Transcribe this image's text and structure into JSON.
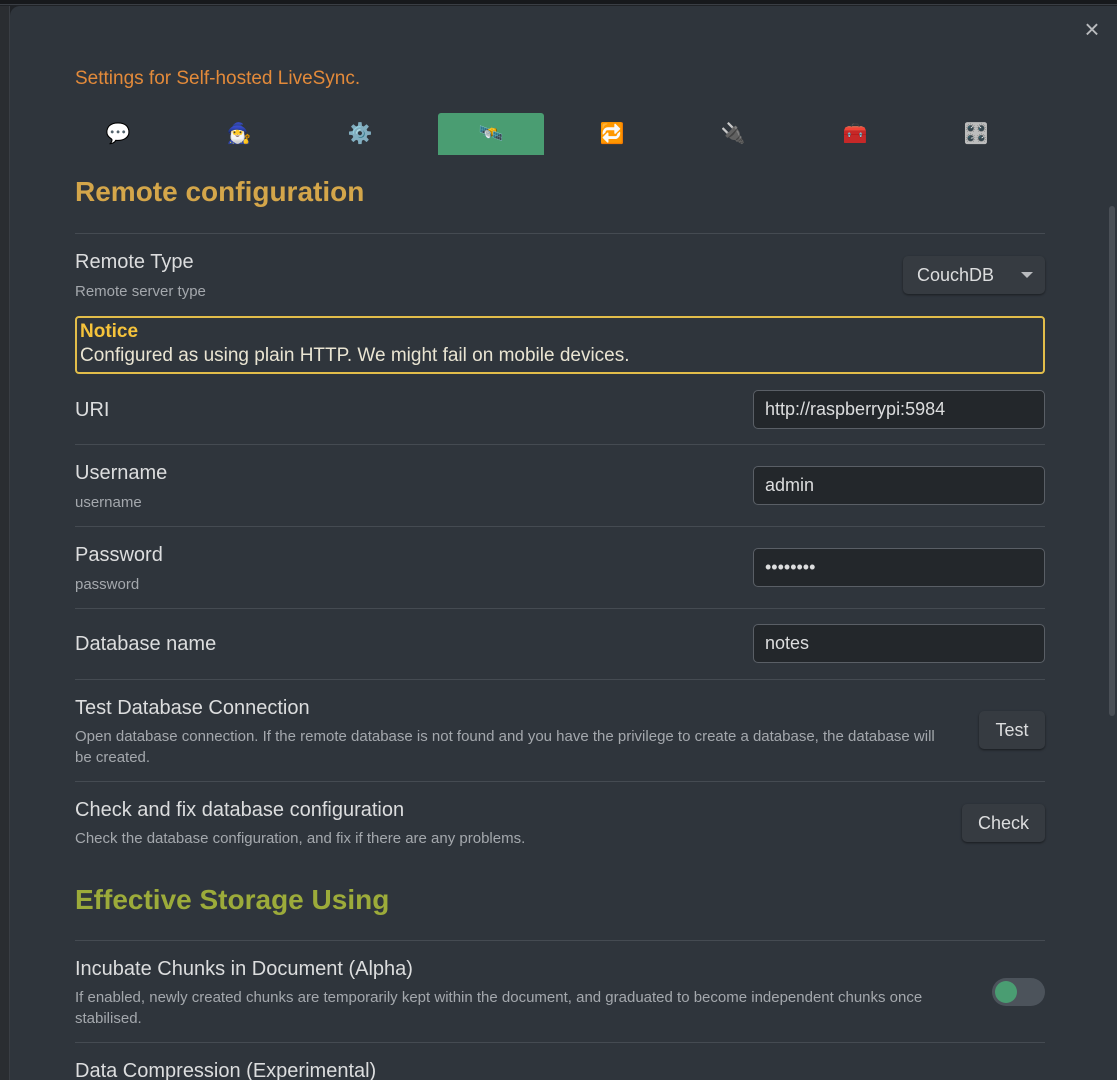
{
  "modal": {
    "title": "Settings for Self-hosted LiveSync.",
    "close_glyph": "×"
  },
  "tabs": [
    {
      "icon": "💬",
      "name": "speech-balloon-icon"
    },
    {
      "icon": "🧙‍♂️",
      "name": "wizard-icon"
    },
    {
      "icon": "⚙️",
      "name": "gear-icon"
    },
    {
      "icon": "🛰️",
      "name": "satellite-icon",
      "active": true
    },
    {
      "icon": "🔁",
      "name": "repeat-icon"
    },
    {
      "icon": "🔌",
      "name": "plug-icon"
    },
    {
      "icon": "🧰",
      "name": "toolbox-icon"
    },
    {
      "icon": "🎛️",
      "name": "control-knobs-icon"
    }
  ],
  "remote_section": {
    "title": "Remote configuration",
    "remote_type": {
      "name": "Remote Type",
      "desc": "Remote server type",
      "value": "CouchDB"
    },
    "notice": {
      "title": "Notice",
      "text": "Configured as using plain HTTP. We might fail on mobile devices."
    },
    "uri": {
      "name": "URI",
      "value": "http://raspberrypi:5984"
    },
    "username": {
      "name": "Username",
      "desc": "username",
      "value": "admin"
    },
    "password": {
      "name": "Password",
      "desc": "password",
      "value": "••••••••"
    },
    "database_name": {
      "name": "Database name",
      "value": "notes"
    },
    "test_connection": {
      "name": "Test Database Connection",
      "desc": "Open database connection. If the remote database is not found and you have the privilege to create a database, the database will be created.",
      "button": "Test"
    },
    "check_config": {
      "name": "Check and fix database configuration",
      "desc": "Check the database configuration, and fix if there are any problems.",
      "button": "Check"
    }
  },
  "storage_section": {
    "title": "Effective Storage Using",
    "incubate": {
      "name": "Incubate Chunks in Document (Alpha)",
      "desc": "If enabled, newly created chunks are temporarily kept within the document, and graduated to become independent chunks once stabilised.",
      "enabled": true
    },
    "compression": {
      "name": "Data Compression (Experimental)"
    }
  },
  "colors": {
    "accent_green": "#4a9d72",
    "section_gold": "#d4a64a",
    "section_olive": "#9cab3a",
    "title_orange": "#e38a3a",
    "notice_border": "#e2bd4a"
  }
}
